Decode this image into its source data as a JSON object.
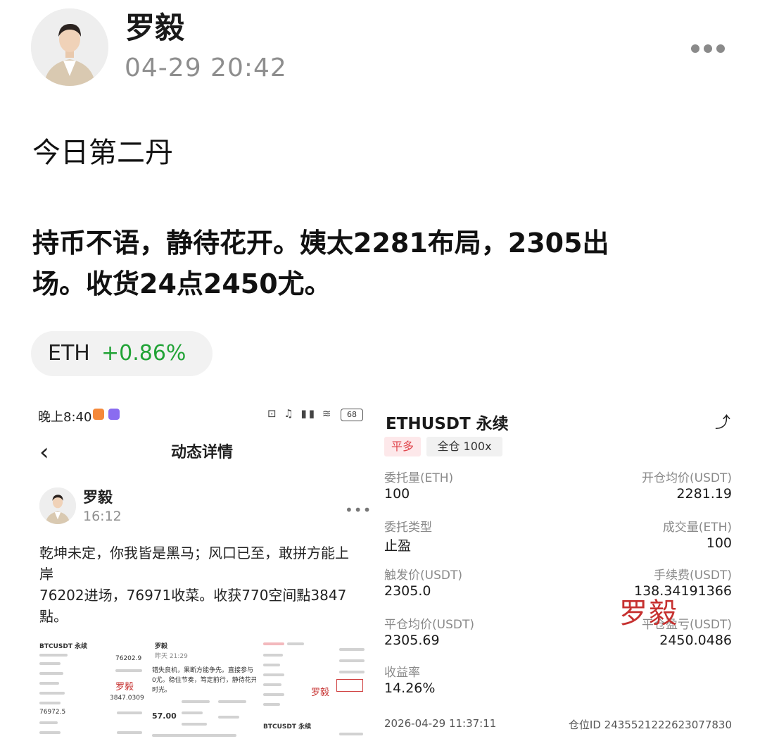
{
  "post": {
    "author": "罗毅",
    "time": "04-29 20:42",
    "title": "今日第二丹",
    "body_lines": [
      "持币不语，静待花开。姨太2281布局，2305出",
      "场。收货24点2450尤。"
    ],
    "ticker": {
      "symbol": "ETH",
      "change": "+0.86%",
      "change_color": "#21a336"
    }
  },
  "left_shot": {
    "status_time": "晚上8:40",
    "battery": "68",
    "nav_title": "动态详情",
    "author": "罗毅",
    "time": "16:12",
    "body_lines": [
      "乾坤未定，你我皆是黑马；风口已至，敢拼方能上",
      "岸",
      "76202进场，76971收菜。收获770空间點3847",
      "點。"
    ],
    "thumb1": {
      "title": "BTCUSDT 永续",
      "v1": "76202.9",
      "v2": "76972.5",
      "v3": "3847.0309",
      "mark": "罗毅"
    },
    "thumb2": {
      "author": "罗毅",
      "time": "昨天 21:29",
      "line1": "错失良机，果断方能争先。直接参与",
      "line2": "0尤。稳住节奏，笃定前行，静待花开",
      "line3": "时光。",
      "mark": "罗毅",
      "num": "57.00"
    },
    "thumb3": {
      "mark": "罗毅",
      "title": "BTCUSDT 永续"
    }
  },
  "right_shot": {
    "title": "ETHUSDT 永续",
    "tag_direction": "平多",
    "tag_mode": "全仓 100x",
    "rows": [
      {
        "label_l": "委托量(ETH)",
        "value_l": "100",
        "label_r": "开仓均价(USDT)",
        "value_r": "2281.19"
      },
      {
        "label_l": "委托类型",
        "value_l": "止盈",
        "label_r": "成交量(ETH)",
        "value_r": "100"
      },
      {
        "label_l": "触发价(USDT)",
        "value_l": "2305.0",
        "label_r": "手续费(USDT)",
        "value_r": "138.34191366"
      },
      {
        "label_l": "平仓均价(USDT)",
        "value_l": "2305.69",
        "label_r": "平仓盈亏(USDT)",
        "value_r": "2450.0486"
      }
    ],
    "roi_label": "收益率",
    "roi_value": "14.26%",
    "watermark": "罗毅",
    "footer_time": "2026-04-29 11:37:11",
    "footer_id": "仓位ID 2435521222623077830"
  }
}
